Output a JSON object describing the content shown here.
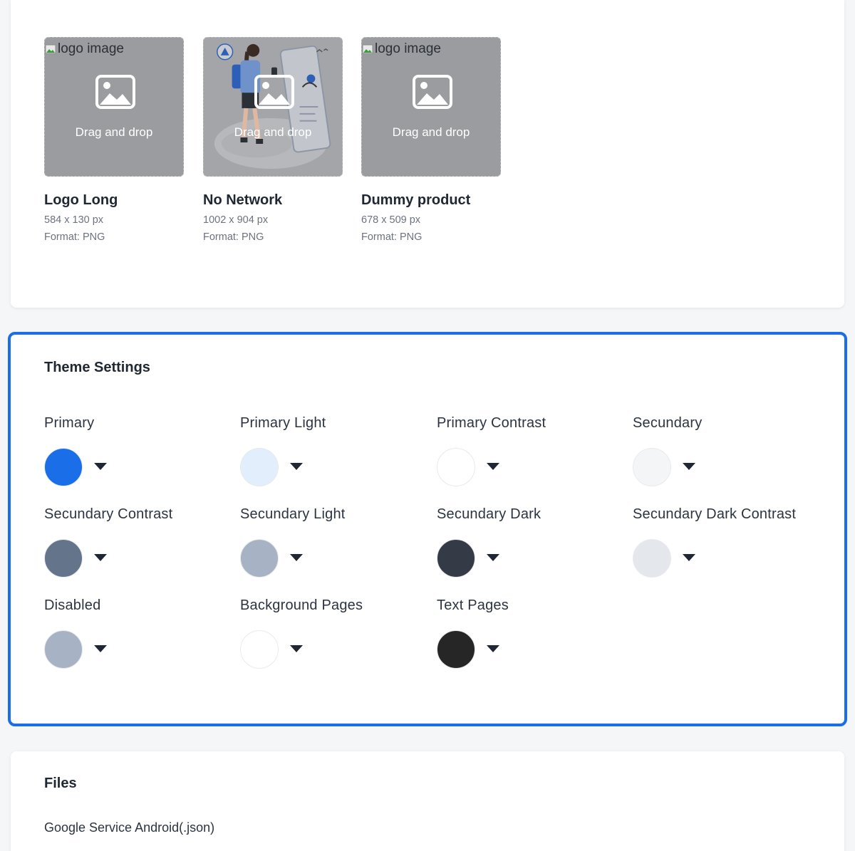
{
  "images": [
    {
      "alt": "logo image",
      "drop_label": "Drag and drop",
      "name": "Logo Long",
      "dimensions": "584 x 130 px",
      "format": "Format: PNG"
    },
    {
      "alt": "",
      "drop_label": "Drag and drop",
      "name": "No Network",
      "dimensions": "1002 x 904 px",
      "format": "Format: PNG"
    },
    {
      "alt": "logo image",
      "drop_label": "Drag and drop",
      "name": "Dummy product",
      "dimensions": "678 x 509 px",
      "format": "Format: PNG"
    }
  ],
  "theme": {
    "title": "Theme Settings",
    "colors": [
      {
        "label": "Primary",
        "value": "#1a6ee8"
      },
      {
        "label": "Primary Light",
        "value": "#e3eefc"
      },
      {
        "label": "Primary Contrast",
        "value": "#ffffff"
      },
      {
        "label": "Secundary",
        "value": "#f4f5f7"
      },
      {
        "label": "Secundary Contrast",
        "value": "#64748b"
      },
      {
        "label": "Secundary Light",
        "value": "#a7b3c4"
      },
      {
        "label": "Secundary Dark",
        "value": "#343b46"
      },
      {
        "label": "Secundary Dark Contrast",
        "value": "#e4e7eb"
      },
      {
        "label": "Disabled",
        "value": "#a7b3c4"
      },
      {
        "label": "Background Pages",
        "value": "#ffffff"
      },
      {
        "label": "Text Pages",
        "value": "#262626"
      }
    ]
  },
  "files": {
    "title": "Files",
    "items": [
      {
        "label": "Google Service Android(.json)"
      }
    ]
  }
}
